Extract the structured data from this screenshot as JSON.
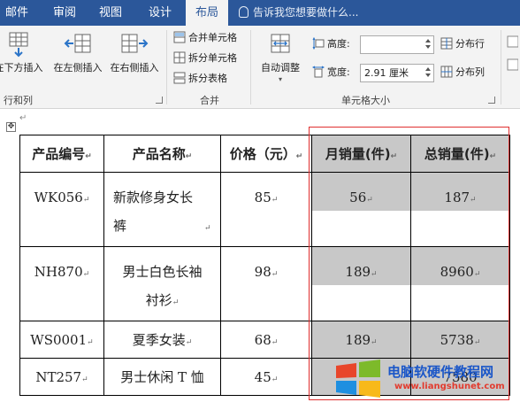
{
  "tabs": [
    {
      "label": "邮件"
    },
    {
      "label": "审阅"
    },
    {
      "label": "视图"
    },
    {
      "label": "设计"
    },
    {
      "label": "布局"
    }
  ],
  "active_tab": "布局",
  "tell_me": "告诉我您想要做什么...",
  "ribbon": {
    "rows_cols": {
      "label": "行和列",
      "insert_below": "在下方插入",
      "insert_left": "在左侧插入",
      "insert_right": "在右侧插入"
    },
    "merge": {
      "label": "合并",
      "merge_cells": "合并单元格",
      "split_cells": "拆分单元格",
      "split_table": "拆分表格"
    },
    "cell_size": {
      "label": "单元格大小",
      "autofit": "自动调整",
      "height_label": "高度:",
      "height_value": "",
      "width_label": "宽度:",
      "width_value": "2.91 厘米",
      "distribute_rows": "分布行",
      "distribute_cols": "分布列"
    }
  },
  "table": {
    "headers": [
      "产品编号",
      "产品名称",
      "价格（元）",
      "月销量(件)",
      "总销量(件)"
    ],
    "rows": [
      {
        "id": "WK056",
        "name_line1": "新款修身女长",
        "name_line2": "裤",
        "price": "85",
        "monthly": "56",
        "total": "187"
      },
      {
        "id": "NH870",
        "name_line1": "男士白色长袖",
        "name_line2": "衬衫",
        "price": "98",
        "monthly": "189",
        "total": "8960"
      },
      {
        "id": "WS0001",
        "name_line1": "夏季女装",
        "name_line2": "",
        "price": "68",
        "monthly": "189",
        "total": "5738"
      },
      {
        "id": "NT257",
        "name_line1": "男士休闲 T 恤",
        "name_line2": "",
        "price": "45",
        "monthly": "",
        "total": "7580"
      }
    ]
  },
  "watermark": {
    "title": "电脑软硬件教程网",
    "url": "www.liangshunet.com"
  },
  "colors": {
    "tabbar": "#2b579a",
    "ribbon": "#f3f3f3",
    "selection": "#c8c8c8",
    "frame": "#e03030"
  }
}
